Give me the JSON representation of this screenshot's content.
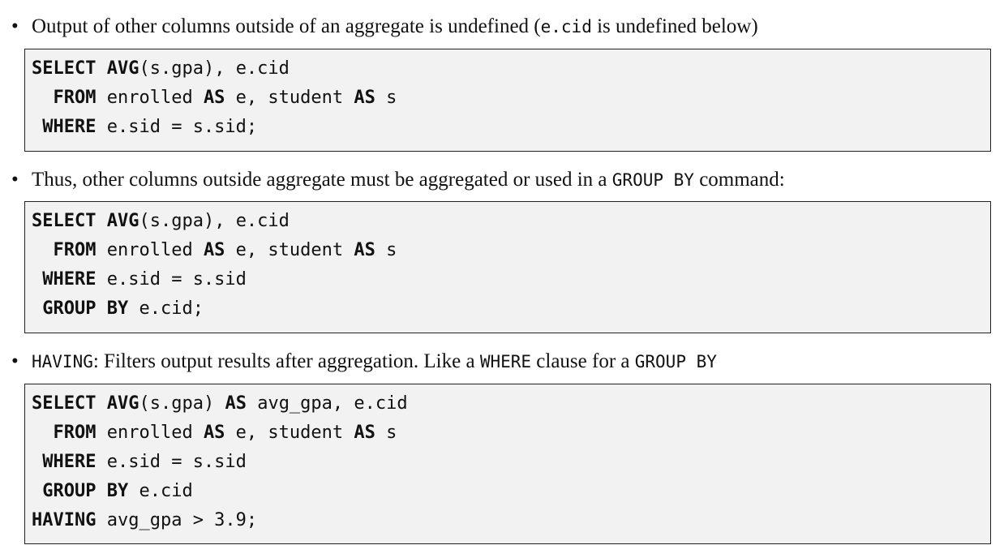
{
  "bullets": [
    {
      "id": "b1",
      "parts": [
        {
          "t": "Output of other columns outside of an aggregate is undefined (",
          "mono": false
        },
        {
          "t": "e.cid",
          "mono": true
        },
        {
          "t": " is undefined below)",
          "mono": false
        }
      ]
    },
    {
      "id": "b2",
      "parts": [
        {
          "t": "Thus, other columns outside aggregate must be aggregated or used in a ",
          "mono": false
        },
        {
          "t": "GROUP BY",
          "mono": true
        },
        {
          "t": " command:",
          "mono": false
        }
      ]
    },
    {
      "id": "b3",
      "parts": [
        {
          "t": "HAVING",
          "mono": true
        },
        {
          "t": ": Filters output results after aggregation. Like a ",
          "mono": false
        },
        {
          "t": "WHERE",
          "mono": true
        },
        {
          "t": " clause for a ",
          "mono": false
        },
        {
          "t": "GROUP BY",
          "mono": true
        }
      ]
    }
  ],
  "code_blocks": [
    {
      "id": "code1",
      "lines": [
        [
          {
            "t": "SELECT",
            "kw": true
          },
          {
            "t": " ",
            "kw": false
          },
          {
            "t": "AVG",
            "kw": true
          },
          {
            "t": "(s.gpa), e.cid",
            "kw": false
          }
        ],
        [
          {
            "t": "  FROM",
            "kw": true
          },
          {
            "t": " enrolled ",
            "kw": false
          },
          {
            "t": "AS",
            "kw": true
          },
          {
            "t": " e, student ",
            "kw": false
          },
          {
            "t": "AS",
            "kw": true
          },
          {
            "t": " s",
            "kw": false
          }
        ],
        [
          {
            "t": " WHERE",
            "kw": true
          },
          {
            "t": " e.sid = s.sid;",
            "kw": false
          }
        ]
      ]
    },
    {
      "id": "code2",
      "lines": [
        [
          {
            "t": "SELECT",
            "kw": true
          },
          {
            "t": " ",
            "kw": false
          },
          {
            "t": "AVG",
            "kw": true
          },
          {
            "t": "(s.gpa), e.cid",
            "kw": false
          }
        ],
        [
          {
            "t": "  FROM",
            "kw": true
          },
          {
            "t": " enrolled ",
            "kw": false
          },
          {
            "t": "AS",
            "kw": true
          },
          {
            "t": " e, student ",
            "kw": false
          },
          {
            "t": "AS",
            "kw": true
          },
          {
            "t": " s",
            "kw": false
          }
        ],
        [
          {
            "t": " WHERE",
            "kw": true
          },
          {
            "t": " e.sid = s.sid",
            "kw": false
          }
        ],
        [
          {
            "t": " GROUP",
            "kw": true
          },
          {
            "t": " ",
            "kw": false
          },
          {
            "t": "BY",
            "kw": true
          },
          {
            "t": " e.cid;",
            "kw": false
          }
        ]
      ]
    },
    {
      "id": "code3",
      "lines": [
        [
          {
            "t": "SELECT",
            "kw": true
          },
          {
            "t": " ",
            "kw": false
          },
          {
            "t": "AVG",
            "kw": true
          },
          {
            "t": "(s.gpa) ",
            "kw": false
          },
          {
            "t": "AS",
            "kw": true
          },
          {
            "t": " avg_gpa, e.cid",
            "kw": false
          }
        ],
        [
          {
            "t": "  FROM",
            "kw": true
          },
          {
            "t": " enrolled ",
            "kw": false
          },
          {
            "t": "AS",
            "kw": true
          },
          {
            "t": " e, student ",
            "kw": false
          },
          {
            "t": "AS",
            "kw": true
          },
          {
            "t": " s",
            "kw": false
          }
        ],
        [
          {
            "t": " WHERE",
            "kw": true
          },
          {
            "t": " e.sid = s.sid",
            "kw": false
          }
        ],
        [
          {
            "t": " GROUP",
            "kw": true
          },
          {
            "t": " ",
            "kw": false
          },
          {
            "t": "BY",
            "kw": true
          },
          {
            "t": " e.cid",
            "kw": false
          }
        ],
        [
          {
            "t": "HAVING",
            "kw": true
          },
          {
            "t": " avg_gpa > 3.9;",
            "kw": false
          }
        ]
      ]
    }
  ]
}
